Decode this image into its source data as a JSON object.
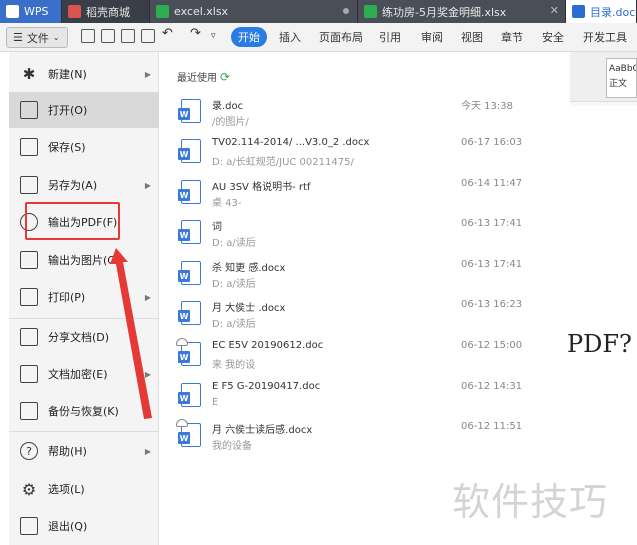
{
  "tabs": [
    {
      "label": "WPS"
    },
    {
      "label": "稻壳商城"
    },
    {
      "label": "excel.xlsx"
    },
    {
      "label": "练功房-5月奖金明细.xlsx"
    },
    {
      "label": "目录.doc"
    }
  ],
  "toolbar": {
    "file_label": "文件",
    "menu_tabs": [
      "开始",
      "插入",
      "页面布局",
      "引用",
      "审阅",
      "视图",
      "章节",
      "安全",
      "开发工具"
    ]
  },
  "left_menu": {
    "items": [
      {
        "label": "新建(N)",
        "icon": "new-icon",
        "has_arrow": true
      },
      {
        "label": "打开(O)",
        "icon": "folder-icon",
        "has_arrow": false
      },
      {
        "label": "保存(S)",
        "icon": "save-icon",
        "has_arrow": false
      },
      {
        "label": "另存为(A)",
        "icon": "save-as-icon",
        "has_arrow": true
      },
      {
        "label": "输出为PDF(F)",
        "icon": "pdf-icon",
        "has_arrow": false
      },
      {
        "label": "输出为图片(G)",
        "icon": "image-icon",
        "has_arrow": false
      },
      {
        "label": "打印(P)",
        "icon": "print-icon",
        "has_arrow": true
      },
      {
        "label": "分享文档(D)",
        "icon": "share-icon",
        "has_arrow": false
      },
      {
        "label": "文档加密(E)",
        "icon": "lock-icon",
        "has_arrow": true
      },
      {
        "label": "备份与恢复(K)",
        "icon": "backup-icon",
        "has_arrow": true
      },
      {
        "label": "帮助(H)",
        "icon": "help-icon",
        "has_arrow": true
      },
      {
        "label": "选项(L)",
        "icon": "gear-icon",
        "has_arrow": false
      },
      {
        "label": "退出(Q)",
        "icon": "exit-icon",
        "has_arrow": false
      }
    ]
  },
  "recent": {
    "title": "最近使用",
    "files": [
      {
        "name": "录.doc",
        "path": "/的图片/",
        "date": "今天 13:38"
      },
      {
        "name": "TV02.114-2014/ ...V3.0_2 .docx",
        "path": "D: a/长虹规范/JUC 00211475/ ",
        "date": "06-17 16:03"
      },
      {
        "name": "AU 3SV 格说明书- rtf",
        "path": "桌 43-",
        "date": "06-14 11:47"
      },
      {
        "name": "词",
        "path": "D: a/读后",
        "date": "06-13 17:41"
      },
      {
        "name": "杀 知更 感.docx",
        "path": "D: a/读后",
        "date": "06-13 17:41"
      },
      {
        "name": "月 大侯士 .docx",
        "path": "D: a/读后",
        "date": "06-13 16:23"
      },
      {
        "name": "EC E5V 20190612.doc",
        "path": "来 我的设",
        "date": "06-12 15:00"
      },
      {
        "name": "E F5 G-20190417.doc",
        "path": "E",
        "date": "06-12 14:31"
      },
      {
        "name": "月 六侯士读后感.docx",
        "path": "我的设备",
        "date": "06-12 11:51"
      }
    ]
  },
  "doc": {
    "style_preview": "AaBbC",
    "style_name": "正文",
    "visible_text": "PDF?"
  },
  "watermark": "软件技巧",
  "colors": {
    "accent": "#2b7be4",
    "highlight": "#e53935",
    "tabbar": "#3a3e47"
  }
}
